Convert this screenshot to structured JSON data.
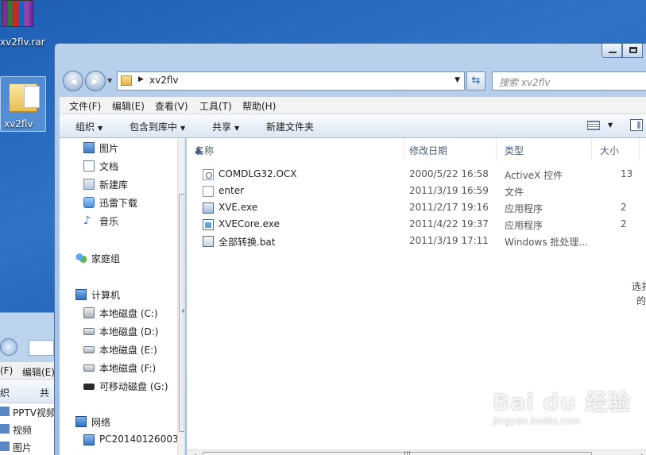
{
  "desktop": {
    "rar_label": "xv2flv.rar",
    "folder_label": "xv2flv"
  },
  "bg_window": {
    "menu_file": "(F)",
    "menu_edit": "编辑(E)",
    "toolbar_organize": "织",
    "toolbar_share": "共",
    "items": [
      {
        "label": "PPTV视频"
      },
      {
        "label": "视频"
      },
      {
        "label": "图片"
      }
    ]
  },
  "window": {
    "address_segment": "xv2flv",
    "search_placeholder": "搜索 xv2flv"
  },
  "menubar": {
    "file": "文件(F)",
    "edit": "编辑(E)",
    "view": "查看(V)",
    "tools": "工具(T)",
    "help": "帮助(H)"
  },
  "cmdbar": {
    "organize": "组织",
    "include_in_library": "包含到库中",
    "share": "共享",
    "new_folder": "新建文件夹"
  },
  "navpane": {
    "items": [
      {
        "label": "图片"
      },
      {
        "label": "文档"
      },
      {
        "label": "新建库"
      },
      {
        "label": "迅雷下载"
      },
      {
        "label": "音乐"
      },
      {
        "label": "家庭组"
      },
      {
        "label": "计算机"
      },
      {
        "label": "本地磁盘 (C:)"
      },
      {
        "label": "本地磁盘 (D:)"
      },
      {
        "label": "本地磁盘 (E:)"
      },
      {
        "label": "本地磁盘 (F:)"
      },
      {
        "label": "可移动磁盘 (G:)"
      },
      {
        "label": "网络"
      },
      {
        "label": "PC20140126003"
      }
    ]
  },
  "filelist": {
    "columns": {
      "name": "名称",
      "date": "修改日期",
      "type": "类型",
      "size": "大小"
    },
    "rows": [
      {
        "name": "COMDLG32.OCX",
        "date": "2000/5/22 16:58",
        "type": "ActiveX 控件",
        "size": "13"
      },
      {
        "name": "enter",
        "date": "2011/3/19 16:59",
        "type": "文件",
        "size": ""
      },
      {
        "name": "XVE.exe",
        "date": "2011/2/17 19:16",
        "type": "应用程序",
        "size": "2"
      },
      {
        "name": "XVECore.exe",
        "date": "2011/4/22 19:37",
        "type": "应用程序",
        "size": "2"
      },
      {
        "name": "全部转换.bat",
        "date": "2011/3/19 17:11",
        "type": "Windows 批处理...",
        "size": ""
      }
    ],
    "side_hint_line1": "选扌",
    "side_hint_line2": "的"
  },
  "watermark": {
    "main": "Bai du 经验",
    "sub": "jingyan.baidu.com"
  }
}
